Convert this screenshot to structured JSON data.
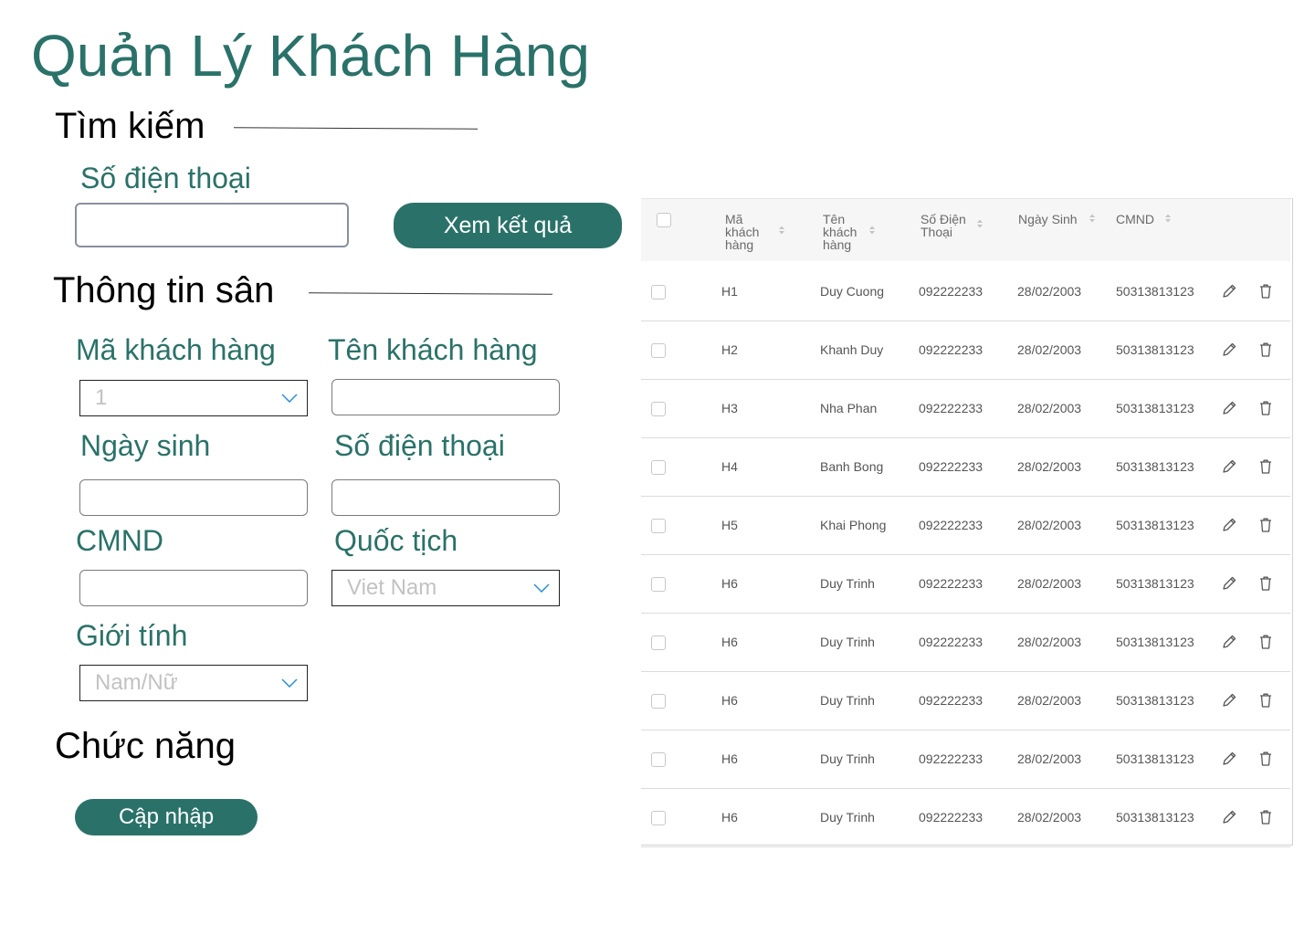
{
  "page": {
    "title": "Quản Lý Khách Hàng"
  },
  "search": {
    "section_title": "Tìm kiếm",
    "phone_label": "Số điện thoại",
    "phone_value": "",
    "submit_label": "Xem kết quả"
  },
  "info": {
    "section_title": "Thông tin sân",
    "customer_id_label": "Mã khách hàng",
    "customer_id_value": "1",
    "customer_name_label": "Tên khách hàng",
    "customer_name_value": "",
    "birthday_label": "Ngày sinh",
    "birthday_value": "",
    "phone_label": "Số điện thoại",
    "phone_value": "",
    "id_card_label": "CMND",
    "id_card_value": "",
    "nationality_label": "Quốc tịch",
    "nationality_value": "Viet Nam",
    "gender_label": "Giới tính",
    "gender_value": "Nam/Nữ"
  },
  "actions": {
    "section_title": "Chức năng",
    "update_label": "Cập nhập"
  },
  "table": {
    "columns": {
      "id": [
        "Mã",
        "khách",
        "hàng"
      ],
      "name": [
        "Tên",
        "khách",
        "hàng"
      ],
      "phone": [
        "Số Điện",
        "Thoại"
      ],
      "birthday": "Ngày Sinh",
      "id_card": "CMND"
    },
    "rows": [
      {
        "id": "H1",
        "name": "Duy Cuong",
        "phone": "092222233",
        "birthday": "28/02/2003",
        "id_card": "50313813123"
      },
      {
        "id": "H2",
        "name": "Khanh Duy",
        "phone": "092222233",
        "birthday": "28/02/2003",
        "id_card": "50313813123"
      },
      {
        "id": "H3",
        "name": "Nha Phan",
        "phone": "092222233",
        "birthday": "28/02/2003",
        "id_card": "50313813123"
      },
      {
        "id": "H4",
        "name": "Banh Bong",
        "phone": "092222233",
        "birthday": "28/02/2003",
        "id_card": "50313813123"
      },
      {
        "id": "H5",
        "name": "Khai Phong",
        "phone": "092222233",
        "birthday": "28/02/2003",
        "id_card": "50313813123"
      },
      {
        "id": "H6",
        "name": "Duy Trinh",
        "phone": "092222233",
        "birthday": "28/02/2003",
        "id_card": "50313813123"
      },
      {
        "id": "H6",
        "name": "Duy Trinh",
        "phone": "092222233",
        "birthday": "28/02/2003",
        "id_card": "50313813123"
      },
      {
        "id": "H6",
        "name": "Duy Trinh",
        "phone": "092222233",
        "birthday": "28/02/2003",
        "id_card": "50313813123"
      },
      {
        "id": "H6",
        "name": "Duy Trinh",
        "phone": "092222233",
        "birthday": "28/02/2003",
        "id_card": "50313813123"
      },
      {
        "id": "H6",
        "name": "Duy Trinh",
        "phone": "092222233",
        "birthday": "28/02/2003",
        "id_card": "50313813123"
      }
    ],
    "row_actions": [
      "pencil-icon",
      "trash-icon"
    ]
  },
  "colors": {
    "accent": "#2a7269",
    "header_bg": "#f6f6f6",
    "table_text": "#555555"
  }
}
